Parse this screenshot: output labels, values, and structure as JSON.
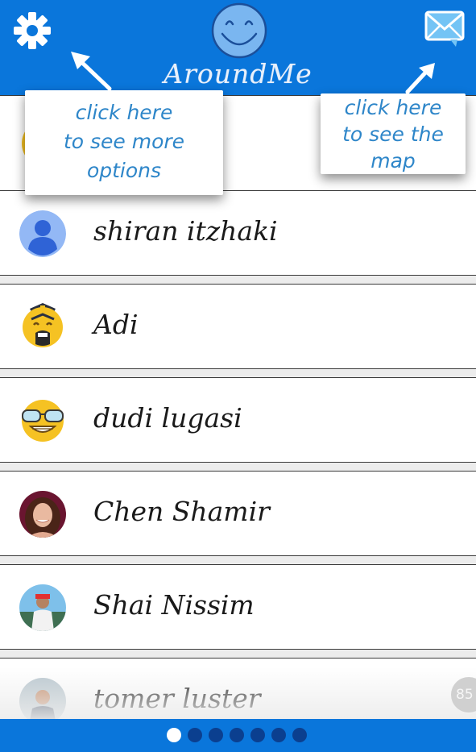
{
  "header": {
    "title": "AroundMe",
    "color": "#0a76db"
  },
  "contacts": [
    {
      "name": "shiran itzhaki",
      "avatar": "default-user-avatar"
    },
    {
      "name": "Adi",
      "avatar": "pilot-emoji-avatar"
    },
    {
      "name": "dudi lugasi",
      "avatar": "sunglasses-emoji-avatar"
    },
    {
      "name": "Chen Shamir",
      "avatar": "photo-avatar"
    },
    {
      "name": "Shai Nissim",
      "avatar": "photo-avatar"
    },
    {
      "name": "tomer luster",
      "avatar": "photo-avatar"
    }
  ],
  "hints": {
    "options": [
      "click here",
      "to see more",
      "options"
    ],
    "map": [
      "click here",
      "to see the",
      "map"
    ]
  },
  "counter": "85",
  "pager": {
    "count": 7,
    "active_index": 0
  }
}
